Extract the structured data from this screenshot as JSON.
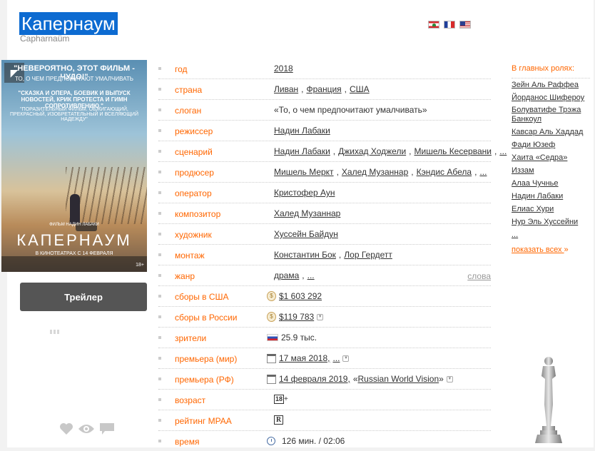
{
  "film": {
    "title": "Капернаум",
    "original_title": "Capharnaüm"
  },
  "flags": [
    "flag-lebanon-icon",
    "flag-france-icon",
    "flag-usa-icon"
  ],
  "poster": {
    "headline": "\"НЕВЕРОЯТНО, ЭТОТ ФИЛЬМ - ЧУДО!\"",
    "tagline": "ТО, О ЧЕМ ПРЕДПОЧИТАЮТ УМАЛЧИВАТЬ",
    "quote": "\"СКАЗКА И ОПЕРА, БОЕВИК И ВЫПУСК НОВОСТЕЙ, КРИК ПРОТЕСТА И ГИМН СОПРОТИВЛЕНИЮ.\"",
    "quote2": "\"ПОРАЗИТЕЛЬНЫЙ ФИЛЬМ. ОБЖИГАЮЩИЙ, ПРЕКРАСНЫЙ, ИЗОБРЕТАТЕЛЬНЫЙ И ВСЕЛЯЮЩИЙ НАДЕЖДУ\"",
    "director_line": "ФИЛЬМ НАДИН ЛАБАКИ",
    "title": "КАПЕРНАУМ",
    "release": "В КИНОТЕАТРАХ С 14 ФЕВРАЛЯ",
    "age": "18+"
  },
  "trailer_label": "Трейлер",
  "info": {
    "year": {
      "label": "год",
      "values": [
        "2018"
      ]
    },
    "country": {
      "label": "страна",
      "values": [
        "Ливан",
        "Франция",
        "США"
      ]
    },
    "slogan": {
      "label": "слоган",
      "text": "«То, о чем предпочитают умалчивать»"
    },
    "director": {
      "label": "режиссер",
      "values": [
        "Надин Лабаки"
      ]
    },
    "writer": {
      "label": "сценарий",
      "values": [
        "Надин Лабаки",
        "Джихад Ходжели",
        "Мишель Кесервани"
      ],
      "more": "..."
    },
    "producer": {
      "label": "продюсер",
      "values": [
        "Мишель Меркт",
        "Халед Музаннар",
        "Кэндис Абела"
      ],
      "more": "..."
    },
    "operator": {
      "label": "оператор",
      "values": [
        "Кристофер Аун"
      ]
    },
    "composer": {
      "label": "композитор",
      "values": [
        "Халед Музаннар"
      ]
    },
    "artist": {
      "label": "художник",
      "values": [
        "Хуссейн Байдун"
      ]
    },
    "editing": {
      "label": "монтаж",
      "values": [
        "Константин Бок",
        "Лор Гердетт"
      ]
    },
    "genre": {
      "label": "жанр",
      "values": [
        "драма"
      ],
      "more": "...",
      "words_link": "слова"
    },
    "box_usa": {
      "label": "сборы в США",
      "value": "$1 603 292"
    },
    "box_ru": {
      "label": "сборы в России",
      "value": "$119 783"
    },
    "viewers": {
      "label": "зрители",
      "value": "25.9 тыс."
    },
    "premiere_world": {
      "label": "премьера (мир)",
      "date": "17 мая 2018,",
      "more": "..."
    },
    "premiere_rf": {
      "label": "премьера (РФ)",
      "date": "14 февраля 2019,",
      "distributor_prefix": "«",
      "distributor": "Russian World Vision",
      "distributor_suffix": "»"
    },
    "age": {
      "label": "возраст",
      "badge": "18",
      "plus": "+"
    },
    "mpaa": {
      "label": "рейтинг MPAA",
      "badge": "R"
    },
    "time": {
      "label": "время",
      "value": "126 мин. / 02:06"
    }
  },
  "cast": {
    "title": "В главных ролях:",
    "names": [
      "Зейн Аль Раффеа",
      "Йорданос Шифероу",
      "Болуватифе Трэжа Банкоул",
      "Кавсар Аль Хаддад",
      "Фади Юзеф",
      "Хаита «Седра» Иззам",
      "Алаа Чучнье",
      "Надин Лабаки",
      "Елиас Хури",
      "Нур Эль Хуссейни"
    ],
    "more": "...",
    "show_all": "показать всех",
    "show_all_arrow": "»"
  }
}
